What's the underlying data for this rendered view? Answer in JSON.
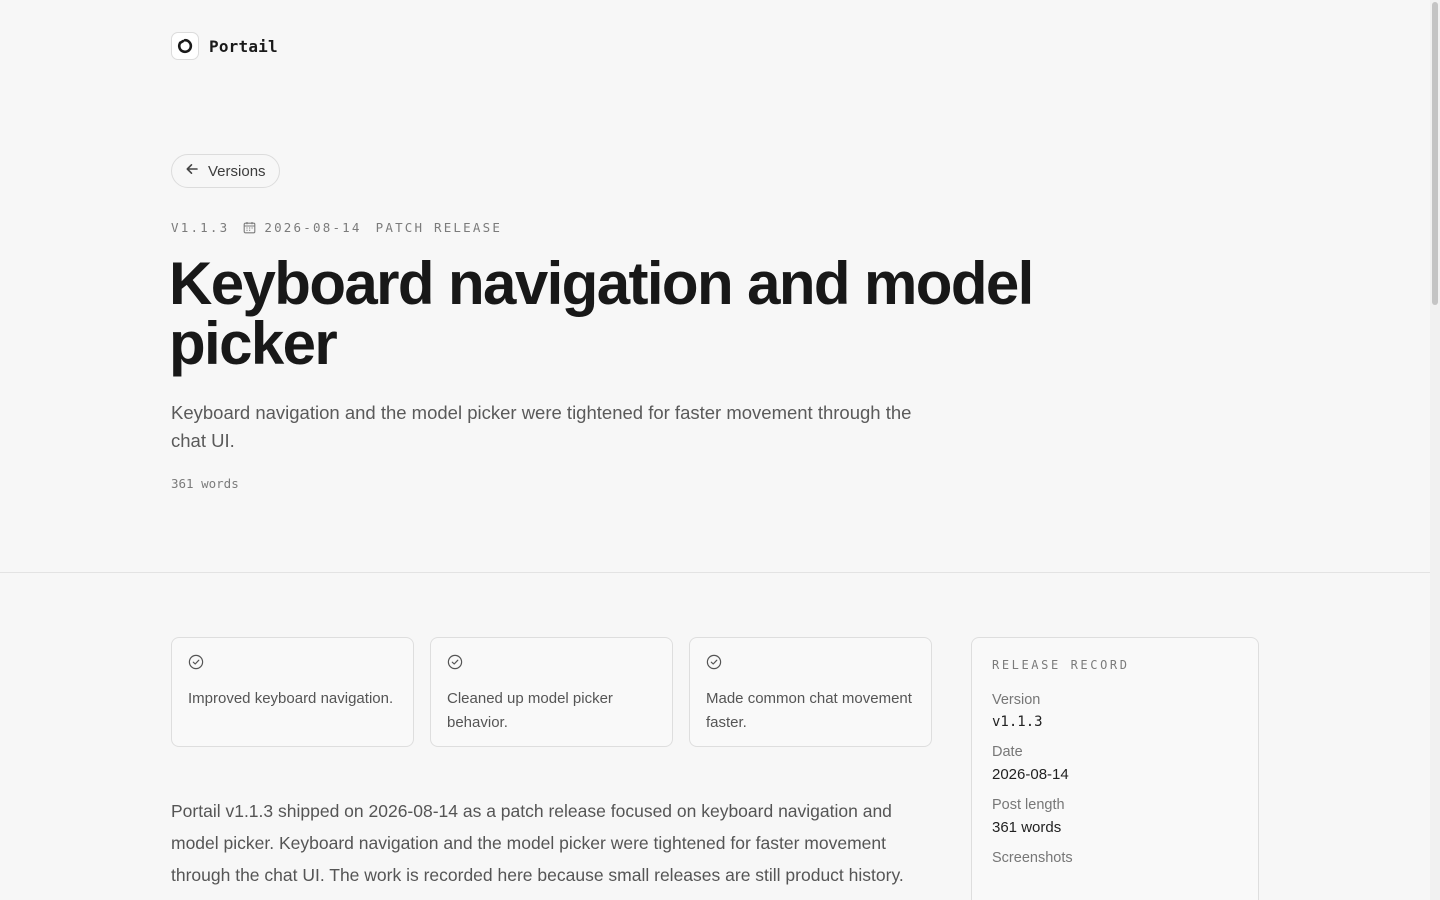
{
  "header": {
    "brand": "Portail"
  },
  "nav": {
    "back_label": "Versions"
  },
  "release": {
    "version": "V1.1.3",
    "date": "2026-08-14",
    "type": "PATCH RELEASE",
    "title": "Keyboard navigation and model picker",
    "subtitle": "Keyboard navigation and the model picker were tightened for faster movement through the chat UI.",
    "word_count": "361 words"
  },
  "highlights": [
    {
      "text": "Improved keyboard navigation."
    },
    {
      "text": "Cleaned up model picker behavior."
    },
    {
      "text": "Made common chat movement faster."
    }
  ],
  "body": "Portail v1.1.3 shipped on 2026-08-14 as a patch release focused on keyboard navigation and model picker. Keyboard navigation and the model picker were tightened for faster movement through the chat UI. The work is recorded here because small releases are still product history. They change",
  "record": {
    "heading": "RELEASE RECORD",
    "rows": [
      {
        "label": "Version",
        "value": "v1.1.3"
      },
      {
        "label": "Date",
        "value": "2026-08-14"
      },
      {
        "label": "Post length",
        "value": "361 words"
      },
      {
        "label": "Screenshots",
        "value": ""
      }
    ]
  },
  "icons": {
    "logo": "portail-logo-icon",
    "back": "arrow-left-icon",
    "calendar": "calendar-icon",
    "check": "check-circle-icon"
  }
}
